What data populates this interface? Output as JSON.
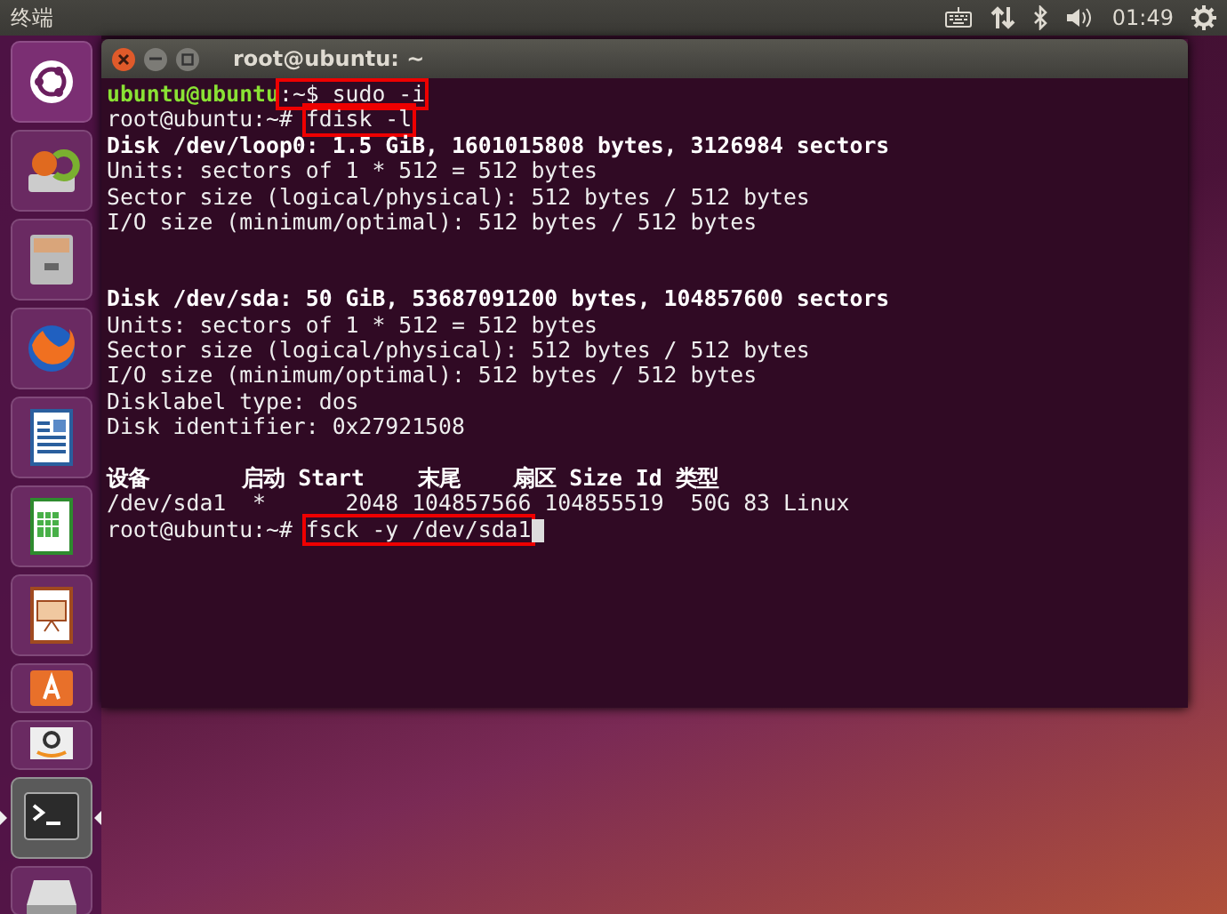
{
  "top_panel": {
    "app_title": "终端",
    "clock": "01:49"
  },
  "launcher": [
    {
      "kind": "ubuntu",
      "running": false
    },
    {
      "kind": "backup",
      "running": false
    },
    {
      "kind": "files",
      "running": false
    },
    {
      "kind": "firefox",
      "running": false
    },
    {
      "kind": "writer",
      "running": false
    },
    {
      "kind": "calc",
      "running": false
    },
    {
      "kind": "impress",
      "running": false
    },
    {
      "kind": "software",
      "running": false
    },
    {
      "kind": "amazon",
      "running": false
    },
    {
      "kind": "terminal",
      "running": true
    },
    {
      "kind": "drive",
      "running": false
    }
  ],
  "window": {
    "title": "root@ubuntu: ~",
    "lines": [
      {
        "segments": [
          {
            "text": "ubuntu@ubuntu",
            "kind": "user",
            "boxed": false
          },
          {
            "text": ":~$ sudo -i",
            "kind": "plain",
            "boxed": true
          }
        ]
      },
      {
        "segments": [
          {
            "text": "root@ubuntu:~# ",
            "kind": "plain",
            "boxed": false
          },
          {
            "text": "fdisk -l",
            "kind": "plain",
            "boxed": true
          }
        ]
      },
      {
        "segments": [
          {
            "text": "Disk /dev/loop0: 1.5 GiB, 1601015808 bytes, 3126984 sectors",
            "kind": "bold",
            "boxed": false
          }
        ]
      },
      {
        "segments": [
          {
            "text": "Units: sectors of 1 * 512 = 512 bytes",
            "kind": "plain",
            "boxed": false
          }
        ]
      },
      {
        "segments": [
          {
            "text": "Sector size (logical/physical): 512 bytes / 512 bytes",
            "kind": "plain",
            "boxed": false
          }
        ]
      },
      {
        "segments": [
          {
            "text": "I/O size (minimum/optimal): 512 bytes / 512 bytes",
            "kind": "plain",
            "boxed": false
          }
        ]
      },
      {
        "kind": "blank"
      },
      {
        "kind": "blank"
      },
      {
        "segments": [
          {
            "text": "Disk /dev/sda: 50 GiB, 53687091200 bytes, 104857600 sectors",
            "kind": "bold",
            "boxed": false
          }
        ]
      },
      {
        "segments": [
          {
            "text": "Units: sectors of 1 * 512 = 512 bytes",
            "kind": "plain",
            "boxed": false
          }
        ]
      },
      {
        "segments": [
          {
            "text": "Sector size (logical/physical): 512 bytes / 512 bytes",
            "kind": "plain",
            "boxed": false
          }
        ]
      },
      {
        "segments": [
          {
            "text": "I/O size (minimum/optimal): 512 bytes / 512 bytes",
            "kind": "plain",
            "boxed": false
          }
        ]
      },
      {
        "segments": [
          {
            "text": "Disklabel type: dos",
            "kind": "plain",
            "boxed": false
          }
        ]
      },
      {
        "segments": [
          {
            "text": "Disk identifier: 0x27921508",
            "kind": "plain",
            "boxed": false
          }
        ]
      },
      {
        "kind": "blank"
      },
      {
        "segments": [
          {
            "text": "设备       启动 Start    末尾    扇区 Size Id 类型",
            "kind": "bold",
            "boxed": false
          }
        ]
      },
      {
        "segments": [
          {
            "text": "/dev/sda1  *      2048 104857566 104855519  50G 83 Linux",
            "kind": "plain",
            "boxed": false
          }
        ]
      },
      {
        "segments": [
          {
            "text": "root@ubuntu:~# ",
            "kind": "plain",
            "boxed": false
          },
          {
            "text": "fsck -y /dev/sda1",
            "kind": "plain",
            "boxed": true
          }
        ],
        "cursor": true
      }
    ]
  }
}
